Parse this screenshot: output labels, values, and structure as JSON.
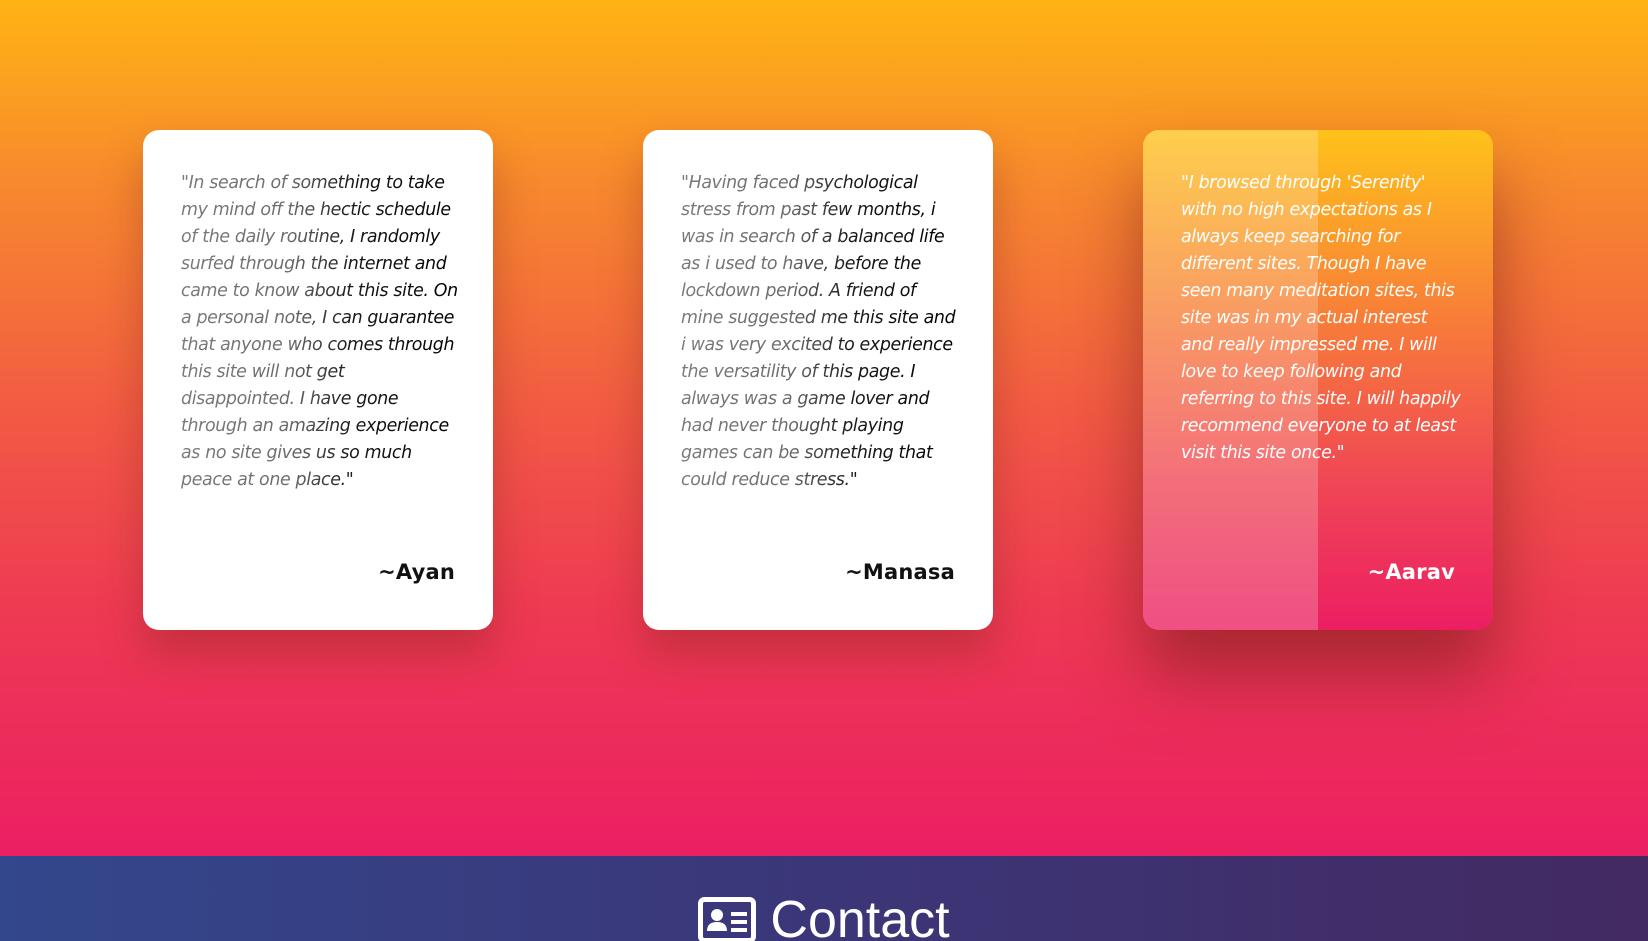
{
  "testimonials": [
    {
      "quote": "\"In search of something to take my mind off the hectic schedule of the daily routine, I randomly surfed through the internet and came to know about this site. On a personal note, I can guarantee that anyone who comes through this site will not get disappointed. I have gone through an amazing experience as no site gives us so much peace at one place.\"",
      "author": "~Ayan"
    },
    {
      "quote": "\"Having faced psychological stress from past few months, i was in search of a balanced life as i used to have, before the lockdown period. A friend of mine suggested me this site and i was very excited to experience the versatility of this page. I always was a game lover and had never thought playing games can be something that could reduce stress.\"",
      "author": "~Manasa"
    },
    {
      "quote": "\"I browsed through 'Serenity' with no high expectations as I always keep searching for different sites. Though I have seen many meditation sites, this site was in my actual interest and really impressed me. I will love to keep following and referring to this site. I will happily recommend everyone to at least visit this site once.\"",
      "author": "~Aarav"
    }
  ],
  "contact": {
    "icon": "contact-card-icon",
    "label": "Contact"
  },
  "colors": {
    "gradient_top": "#ffb314",
    "gradient_bottom": "#eb1f63",
    "contact_bar": "#3b3678",
    "card_background": "#ffffff"
  }
}
